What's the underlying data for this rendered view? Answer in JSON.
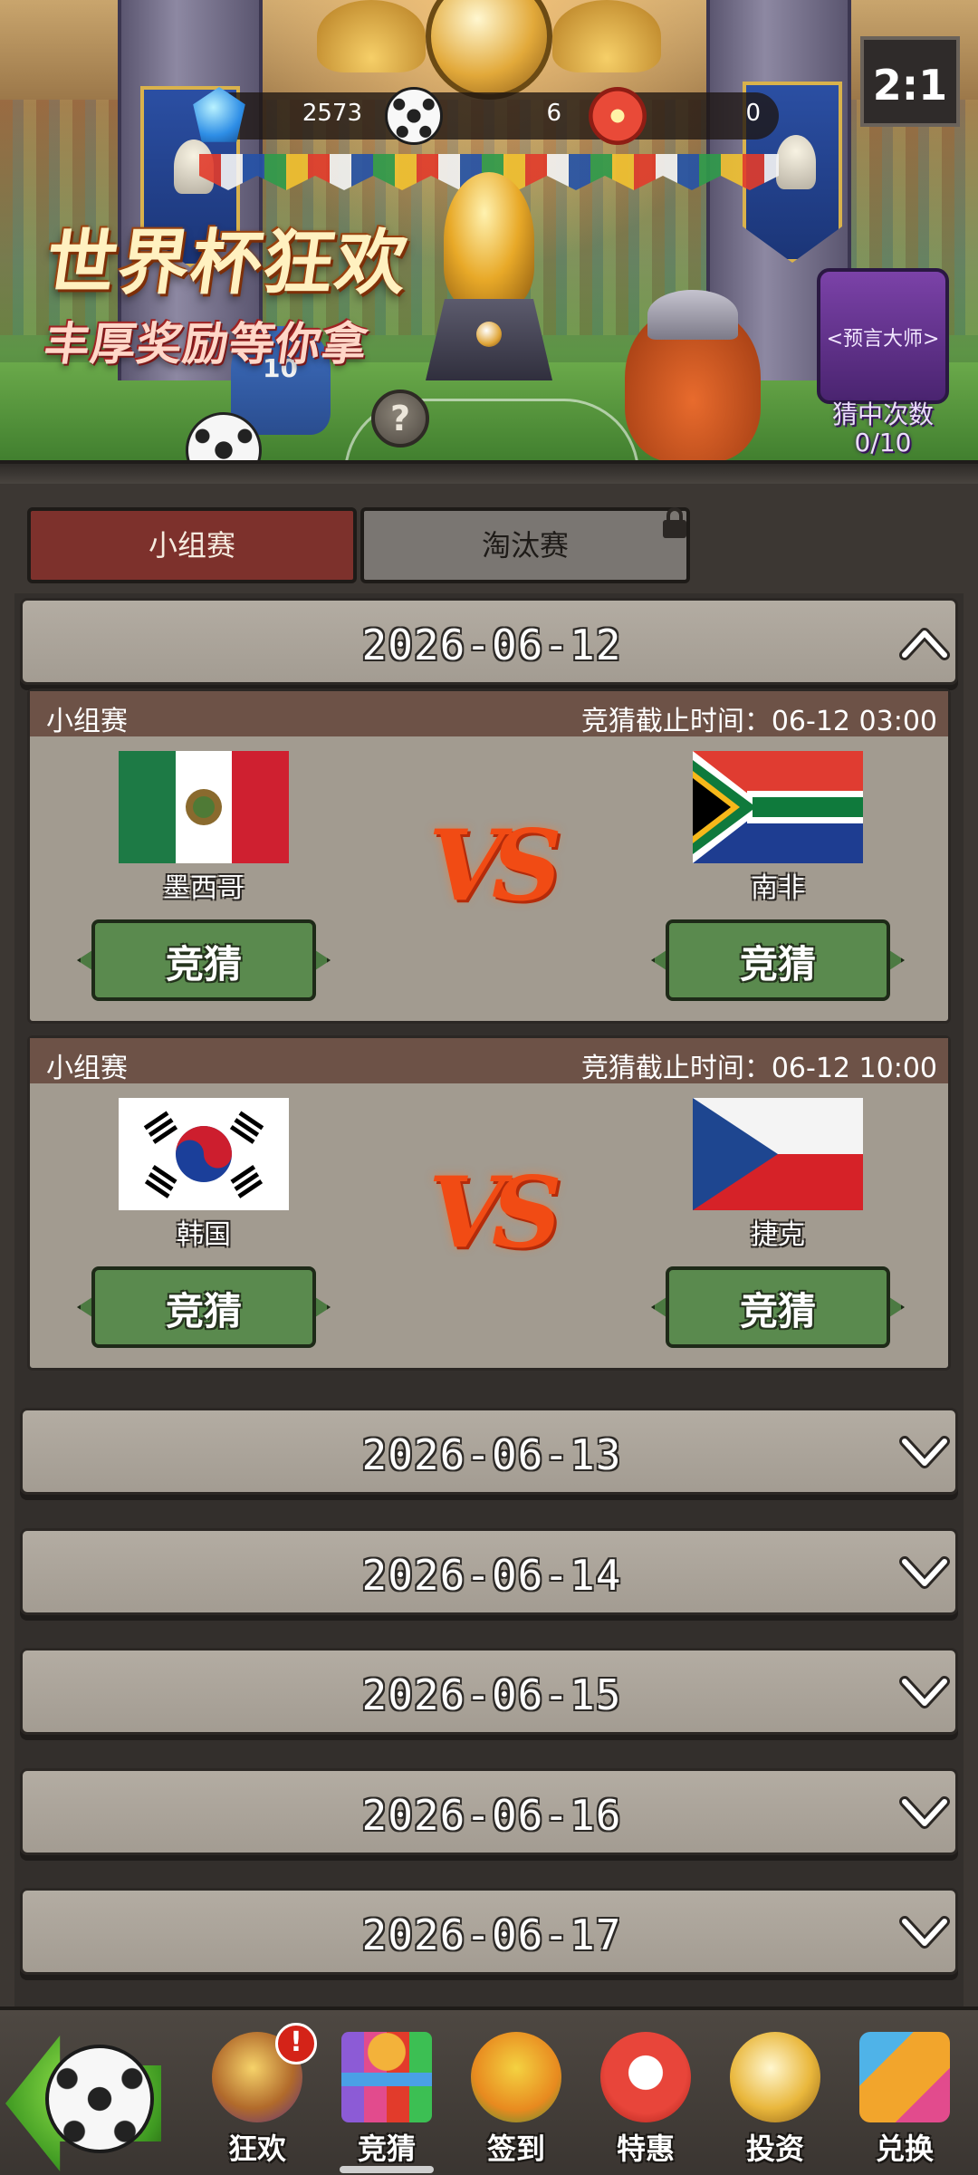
{
  "resources": {
    "gems": "2573",
    "balls": "6",
    "medals": "0"
  },
  "banner": {
    "title": "世界杯狂欢",
    "subtitle": "丰厚奖励等你拿",
    "help": "?",
    "scoreboard": "2:1",
    "player_number": "10",
    "prophet_title": "<预言大师>",
    "prophet_count_label": "猜中次数",
    "prophet_count": "0/10"
  },
  "tabs": [
    {
      "label": "小组赛",
      "active": true,
      "locked": false
    },
    {
      "label": "淘汰赛",
      "active": false,
      "locked": true
    }
  ],
  "dates": [
    {
      "date": "2026-06-12",
      "expanded": true,
      "matches": [
        {
          "type": "小组赛",
          "deadline": "竞猜截止时间：06-12 03:00",
          "home": "墨西哥",
          "away": "南非",
          "vs": "VS",
          "guess_label": "竞猜"
        },
        {
          "type": "小组赛",
          "deadline": "竞猜截止时间：06-12 10:00",
          "home": "韩国",
          "away": "捷克",
          "vs": "VS",
          "guess_label": "竞猜"
        }
      ]
    },
    {
      "date": "2026-06-13",
      "expanded": false
    },
    {
      "date": "2026-06-14",
      "expanded": false
    },
    {
      "date": "2026-06-15",
      "expanded": false
    },
    {
      "date": "2026-06-16",
      "expanded": false
    },
    {
      "date": "2026-06-17",
      "expanded": false
    }
  ],
  "bottom_nav": [
    {
      "label": "狂欢",
      "icon": "carnival-icon",
      "badge": "!"
    },
    {
      "label": "竞猜",
      "icon": "bracket-icon",
      "active": true
    },
    {
      "label": "签到",
      "icon": "boots-icon"
    },
    {
      "label": "特惠",
      "icon": "megaphone-icon"
    },
    {
      "label": "投资",
      "icon": "invest-icon"
    },
    {
      "label": "兑换",
      "icon": "exchange-icon"
    }
  ],
  "colors": {
    "tab_active": "#7d312c",
    "tab_inactive": "#7a7672",
    "guess_button": "#5a8a4e",
    "match_strip": "#6d5247",
    "vs": "#f14b14",
    "prophet_panel": "#7b42a8"
  }
}
